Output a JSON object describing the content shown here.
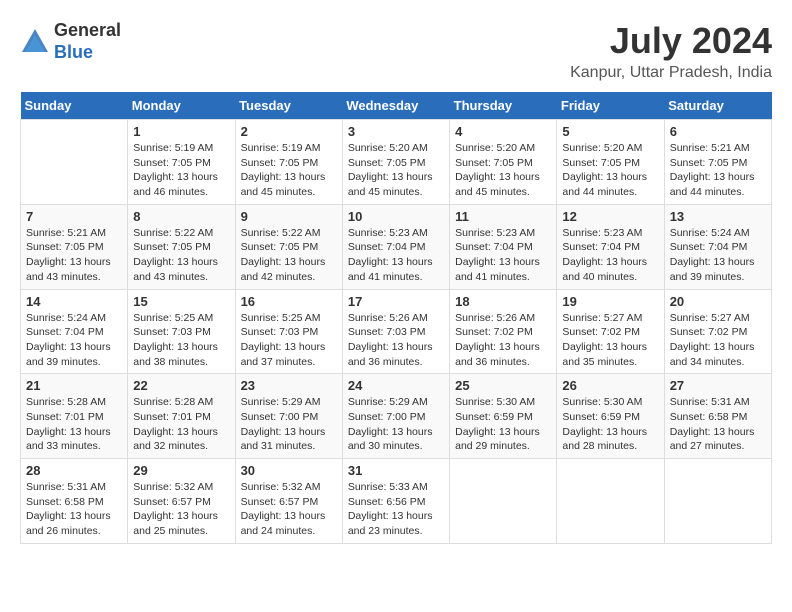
{
  "header": {
    "logo_line1": "General",
    "logo_line2": "Blue",
    "main_title": "July 2024",
    "subtitle": "Kanpur, Uttar Pradesh, India"
  },
  "calendar": {
    "days_of_week": [
      "Sunday",
      "Monday",
      "Tuesday",
      "Wednesday",
      "Thursday",
      "Friday",
      "Saturday"
    ],
    "weeks": [
      [
        {
          "day": "",
          "details": ""
        },
        {
          "day": "1",
          "details": "Sunrise: 5:19 AM\nSunset: 7:05 PM\nDaylight: 13 hours\nand 46 minutes."
        },
        {
          "day": "2",
          "details": "Sunrise: 5:19 AM\nSunset: 7:05 PM\nDaylight: 13 hours\nand 45 minutes."
        },
        {
          "day": "3",
          "details": "Sunrise: 5:20 AM\nSunset: 7:05 PM\nDaylight: 13 hours\nand 45 minutes."
        },
        {
          "day": "4",
          "details": "Sunrise: 5:20 AM\nSunset: 7:05 PM\nDaylight: 13 hours\nand 45 minutes."
        },
        {
          "day": "5",
          "details": "Sunrise: 5:20 AM\nSunset: 7:05 PM\nDaylight: 13 hours\nand 44 minutes."
        },
        {
          "day": "6",
          "details": "Sunrise: 5:21 AM\nSunset: 7:05 PM\nDaylight: 13 hours\nand 44 minutes."
        }
      ],
      [
        {
          "day": "7",
          "details": "Sunrise: 5:21 AM\nSunset: 7:05 PM\nDaylight: 13 hours\nand 43 minutes."
        },
        {
          "day": "8",
          "details": "Sunrise: 5:22 AM\nSunset: 7:05 PM\nDaylight: 13 hours\nand 43 minutes."
        },
        {
          "day": "9",
          "details": "Sunrise: 5:22 AM\nSunset: 7:05 PM\nDaylight: 13 hours\nand 42 minutes."
        },
        {
          "day": "10",
          "details": "Sunrise: 5:23 AM\nSunset: 7:04 PM\nDaylight: 13 hours\nand 41 minutes."
        },
        {
          "day": "11",
          "details": "Sunrise: 5:23 AM\nSunset: 7:04 PM\nDaylight: 13 hours\nand 41 minutes."
        },
        {
          "day": "12",
          "details": "Sunrise: 5:23 AM\nSunset: 7:04 PM\nDaylight: 13 hours\nand 40 minutes."
        },
        {
          "day": "13",
          "details": "Sunrise: 5:24 AM\nSunset: 7:04 PM\nDaylight: 13 hours\nand 39 minutes."
        }
      ],
      [
        {
          "day": "14",
          "details": "Sunrise: 5:24 AM\nSunset: 7:04 PM\nDaylight: 13 hours\nand 39 minutes."
        },
        {
          "day": "15",
          "details": "Sunrise: 5:25 AM\nSunset: 7:03 PM\nDaylight: 13 hours\nand 38 minutes."
        },
        {
          "day": "16",
          "details": "Sunrise: 5:25 AM\nSunset: 7:03 PM\nDaylight: 13 hours\nand 37 minutes."
        },
        {
          "day": "17",
          "details": "Sunrise: 5:26 AM\nSunset: 7:03 PM\nDaylight: 13 hours\nand 36 minutes."
        },
        {
          "day": "18",
          "details": "Sunrise: 5:26 AM\nSunset: 7:02 PM\nDaylight: 13 hours\nand 36 minutes."
        },
        {
          "day": "19",
          "details": "Sunrise: 5:27 AM\nSunset: 7:02 PM\nDaylight: 13 hours\nand 35 minutes."
        },
        {
          "day": "20",
          "details": "Sunrise: 5:27 AM\nSunset: 7:02 PM\nDaylight: 13 hours\nand 34 minutes."
        }
      ],
      [
        {
          "day": "21",
          "details": "Sunrise: 5:28 AM\nSunset: 7:01 PM\nDaylight: 13 hours\nand 33 minutes."
        },
        {
          "day": "22",
          "details": "Sunrise: 5:28 AM\nSunset: 7:01 PM\nDaylight: 13 hours\nand 32 minutes."
        },
        {
          "day": "23",
          "details": "Sunrise: 5:29 AM\nSunset: 7:00 PM\nDaylight: 13 hours\nand 31 minutes."
        },
        {
          "day": "24",
          "details": "Sunrise: 5:29 AM\nSunset: 7:00 PM\nDaylight: 13 hours\nand 30 minutes."
        },
        {
          "day": "25",
          "details": "Sunrise: 5:30 AM\nSunset: 6:59 PM\nDaylight: 13 hours\nand 29 minutes."
        },
        {
          "day": "26",
          "details": "Sunrise: 5:30 AM\nSunset: 6:59 PM\nDaylight: 13 hours\nand 28 minutes."
        },
        {
          "day": "27",
          "details": "Sunrise: 5:31 AM\nSunset: 6:58 PM\nDaylight: 13 hours\nand 27 minutes."
        }
      ],
      [
        {
          "day": "28",
          "details": "Sunrise: 5:31 AM\nSunset: 6:58 PM\nDaylight: 13 hours\nand 26 minutes."
        },
        {
          "day": "29",
          "details": "Sunrise: 5:32 AM\nSunset: 6:57 PM\nDaylight: 13 hours\nand 25 minutes."
        },
        {
          "day": "30",
          "details": "Sunrise: 5:32 AM\nSunset: 6:57 PM\nDaylight: 13 hours\nand 24 minutes."
        },
        {
          "day": "31",
          "details": "Sunrise: 5:33 AM\nSunset: 6:56 PM\nDaylight: 13 hours\nand 23 minutes."
        },
        {
          "day": "",
          "details": ""
        },
        {
          "day": "",
          "details": ""
        },
        {
          "day": "",
          "details": ""
        }
      ]
    ]
  }
}
